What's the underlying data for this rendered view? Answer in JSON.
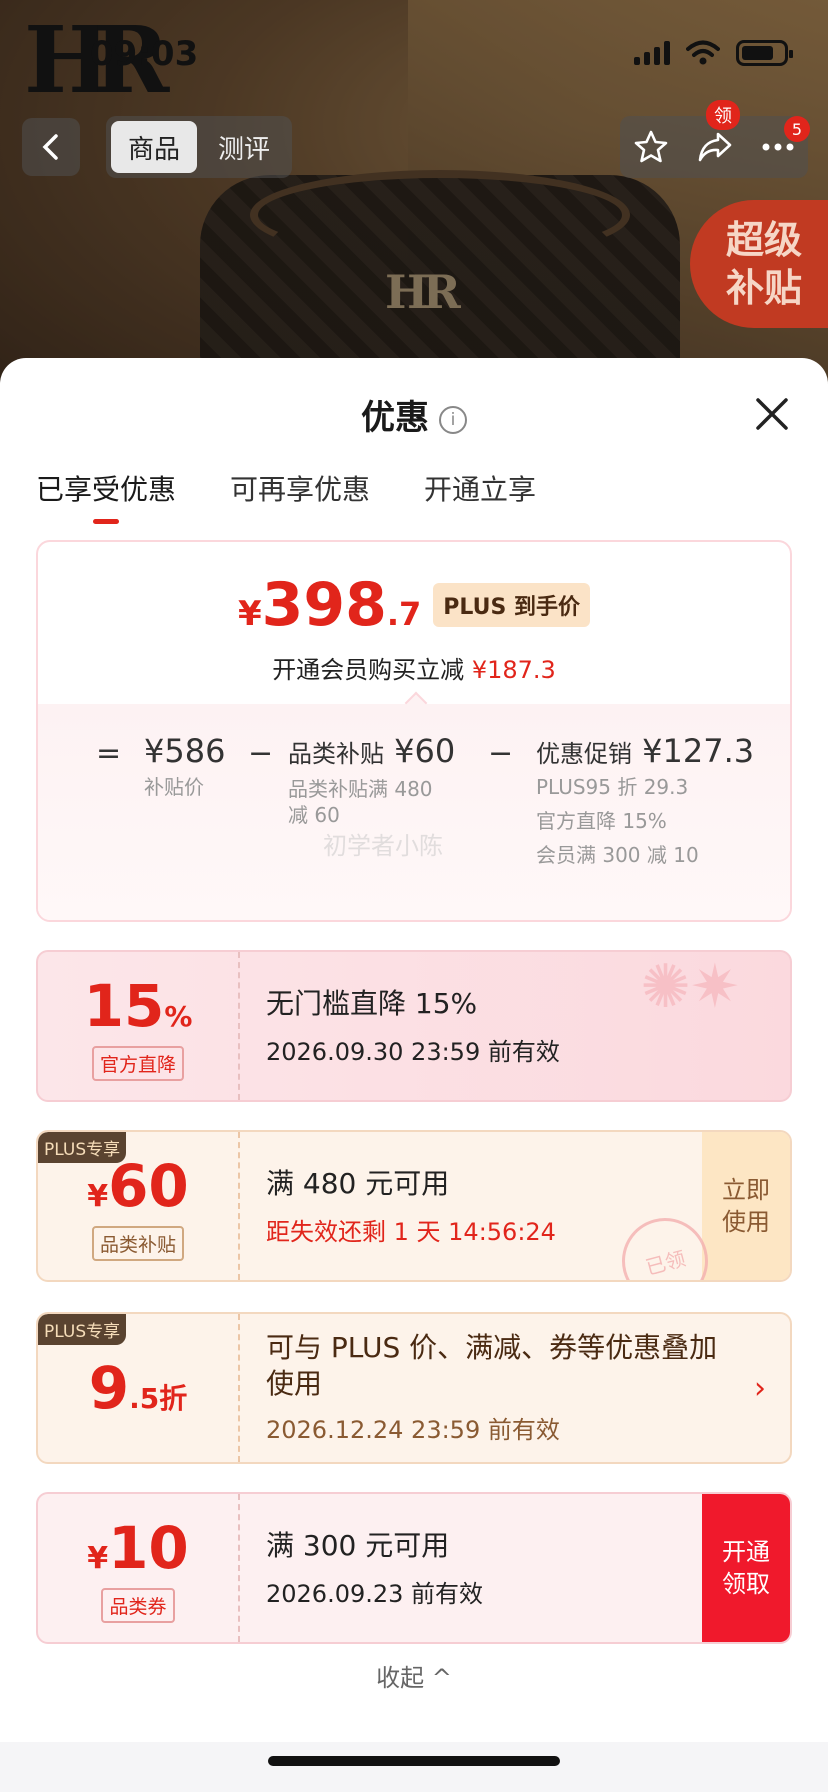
{
  "status_bar": {
    "time": "09:03"
  },
  "brand_logo": "HR",
  "nav": {
    "tabs": [
      "商品",
      "测评"
    ],
    "active_tab": "商品",
    "badge_ling": "领",
    "badge_count": "5",
    "super_tag": "超级\n补贴"
  },
  "sheet": {
    "title": "优惠",
    "tabs": [
      "已享受优惠",
      "可再享优惠",
      "开通立享"
    ],
    "active_tab_index": 0
  },
  "price": {
    "currency": "¥",
    "int": "398",
    "dec": ".7",
    "plus_label": "PLUS 到手价",
    "sub_text": "开通会员购买立减",
    "sub_amount": "¥187.3",
    "formula": {
      "eq": "=",
      "minus": "−",
      "base_value": "¥586",
      "base_note": "补贴价",
      "subsidy_label": "品类补贴",
      "subsidy_value": "¥60",
      "subsidy_note1": "品类补贴满 480",
      "subsidy_note2": "减 60",
      "promo_label": "优惠促销",
      "promo_value": "¥127.3",
      "promo_note1": "PLUS95 折 29.3",
      "promo_note2": "官方直降 15%",
      "promo_note3": "会员满 300 减 10"
    },
    "watermark": "初学者小陈"
  },
  "coupons": [
    {
      "big": "15",
      "unit": "%",
      "tag": "官方直降",
      "title": "无门槛直降 15%",
      "sub": "2026.09.30 23:59 前有效"
    },
    {
      "corner": "PLUS专享",
      "prefix": "¥",
      "big": "60",
      "tag": "品类补贴",
      "title": "满 480 元可用",
      "sub": "距失效还剩 1 天 14:56:24",
      "button": "立即\n使用",
      "stamp": "已领"
    },
    {
      "corner": "PLUS专享",
      "big": "9",
      "unit": ".5折",
      "title": "可与 PLUS 价、满减、券等优惠叠加使用",
      "sub": "2026.12.24 23:59 前有效",
      "arrow": "›"
    },
    {
      "prefix": "¥",
      "big": "10",
      "tag": "品类券",
      "title": "满 300 元可用",
      "sub": "2026.09.23 前有效",
      "button": "开通\n领取"
    }
  ],
  "collapse_label": "收起 ^",
  "colors": {
    "accent_red": "#e1251b",
    "plus_brown": "#5a4330"
  }
}
